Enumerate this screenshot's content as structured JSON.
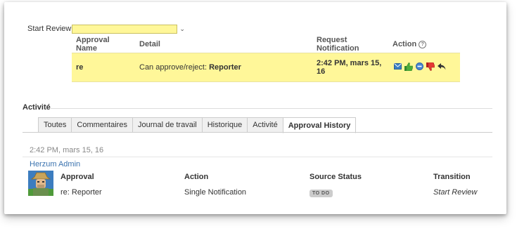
{
  "start_review": {
    "label": "Start Review"
  },
  "approvals": {
    "headers": {
      "name": "Approval Name",
      "detail": "Detail",
      "request_notification": "Request Notification",
      "action": "Action"
    },
    "row": {
      "name": "re",
      "detail_prefix": "Can approve/reject:",
      "detail_role": "Reporter",
      "notification_line1": "2:42 PM, mars 15,",
      "notification_line2": "16"
    },
    "action_icons": [
      "envelope-icon",
      "thumbs-up-icon",
      "minus-circle-icon",
      "thumbs-down-icon",
      "reply-arrow-icon"
    ]
  },
  "activity": {
    "title": "Activité",
    "tabs": [
      "Toutes",
      "Commentaires",
      "Journal de travail",
      "Historique",
      "Activité",
      "Approval History"
    ],
    "active_tab": "Approval History"
  },
  "history": {
    "timestamp": "2:42 PM, mars 15, 16",
    "author": "Herzum Admin",
    "headers": {
      "approval": "Approval",
      "action": "Action",
      "source_status": "Source Status",
      "transition": "Transition"
    },
    "row": {
      "approval": "re: Reporter",
      "action": "Single Notification",
      "source_status": "TO DO",
      "transition": "Start Review"
    }
  },
  "colors": {
    "highlight": "#fff799",
    "link": "#3b73af",
    "muted": "#888888"
  }
}
